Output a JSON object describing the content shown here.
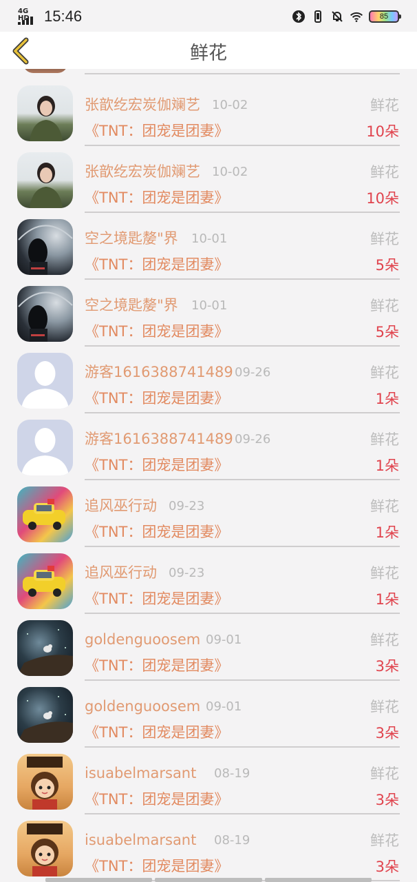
{
  "status_bar": {
    "network": "4G HD",
    "time": "15:46",
    "battery": "85",
    "icons": [
      "signal-icon",
      "bluetooth-icon",
      "vibrate-icon",
      "silent-bell-icon",
      "wifi-icon",
      "battery-icon"
    ]
  },
  "nav": {
    "back_icon": "chevron-left-icon",
    "title": "鲜花"
  },
  "colors": {
    "username": "#e19a72",
    "title": "#e28a60",
    "amount": "#e0434d",
    "back_icon": "#e7c13a"
  },
  "rows": [
    {
      "avatar": "woman-portrait",
      "username": "张歆纥宏炭伽斓艺",
      "date": "10-02",
      "gift_type": "鲜花",
      "book_title": "《TNT：团宠是团妻》",
      "amount": "10朵"
    },
    {
      "avatar": "woman-portrait",
      "username": "张歆纥宏炭伽斓艺",
      "date": "10-02",
      "gift_type": "鲜花",
      "book_title": "《TNT：团宠是团妻》",
      "amount": "10朵"
    },
    {
      "avatar": "umbrella-girl",
      "username": "空之境匙嫠\"界",
      "date": "10-01",
      "gift_type": "鲜花",
      "book_title": "《TNT：团宠是团妻》",
      "amount": "5朵"
    },
    {
      "avatar": "umbrella-girl",
      "username": "空之境匙嫠\"界",
      "date": "10-01",
      "gift_type": "鲜花",
      "book_title": "《TNT：团宠是团妻》",
      "amount": "5朵"
    },
    {
      "avatar": "default-user",
      "username": "游客1616388741489",
      "date": "09-26",
      "gift_type": "鲜花",
      "book_title": "《TNT：团宠是团妻》",
      "amount": "1朵"
    },
    {
      "avatar": "default-user",
      "username": "游客1616388741489",
      "date": "09-26",
      "gift_type": "鲜花",
      "book_title": "《TNT：团宠是团妻》",
      "amount": "1朵"
    },
    {
      "avatar": "toy-car",
      "username": "追风巫行动",
      "date": "09-23",
      "gift_type": "鲜花",
      "book_title": "《TNT：团宠是团妻》",
      "amount": "1朵"
    },
    {
      "avatar": "toy-car",
      "username": "追风巫行动",
      "date": "09-23",
      "gift_type": "鲜花",
      "book_title": "《TNT：团宠是团妻》",
      "amount": "1朵"
    },
    {
      "avatar": "night-bird",
      "username": "goldenguoosem",
      "date": "09-01",
      "gift_type": "鲜花",
      "book_title": "《TNT：团宠是团妻》",
      "amount": "3朵"
    },
    {
      "avatar": "night-bird",
      "username": "goldenguoosem",
      "date": "09-01",
      "gift_type": "鲜花",
      "book_title": "《TNT：团宠是团妻》",
      "amount": "3朵"
    },
    {
      "avatar": "cartoon-book",
      "username": "isuabelmarsant",
      "date": "08-19",
      "gift_type": "鲜花",
      "book_title": "《TNT：团宠是团妻》",
      "amount": "3朵"
    },
    {
      "avatar": "cartoon-book",
      "username": "isuabelmarsant",
      "date": "08-19",
      "gift_type": "鲜花",
      "book_title": "《TNT：团宠是团妻》",
      "amount": "3朵"
    }
  ]
}
